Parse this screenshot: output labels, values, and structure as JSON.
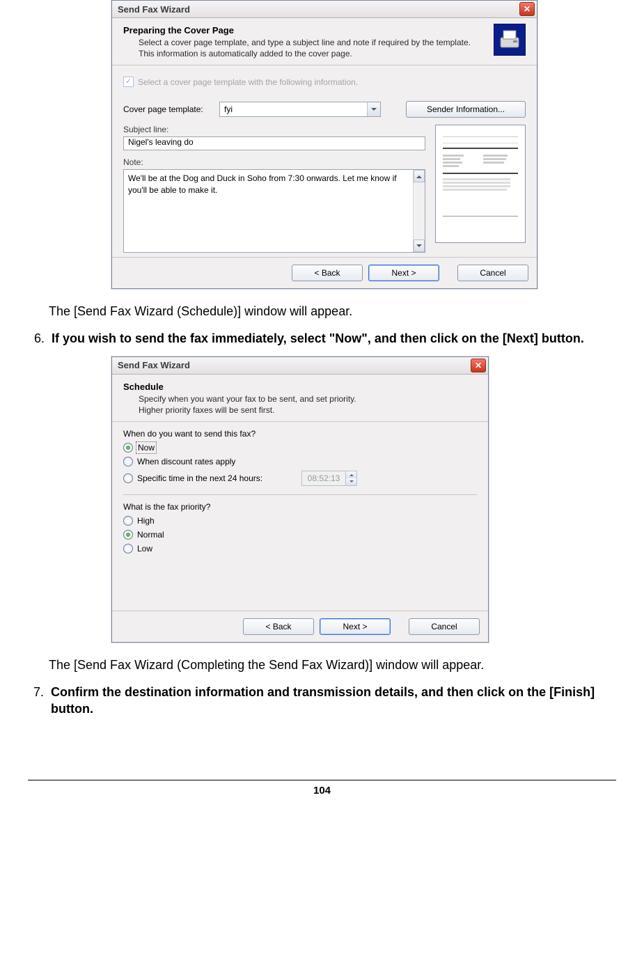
{
  "wizard1": {
    "title": "Send Fax Wizard",
    "heading": "Preparing the Cover Page",
    "sub1": "Select a cover page template, and type a subject line and note if required by the template.",
    "sub2": "This information is automatically added to the cover page.",
    "checkbox_label": "Select a cover page template with the following information.",
    "template_label": "Cover page template:",
    "template_value": "fyi",
    "sender_btn": "Sender Information...",
    "subject_label": "Subject line:",
    "subject_value": "Nigel's leaving do",
    "note_label": "Note:",
    "note_value": "We'll be at the Dog and Duck in Soho from 7:30 onwards. Let me know if you'll be able to make it.",
    "back": "< Back",
    "next": "Next >",
    "cancel": "Cancel"
  },
  "doc": {
    "after1": "The [Send Fax Wizard (Schedule)] window will appear.",
    "step6_num": "6.",
    "step6": "If you wish to send the fax immediately, select \"Now\", and then click on the [Next] button.",
    "after2": "The [Send Fax Wizard (Completing the Send Fax Wizard)] window will appear.",
    "step7_num": "7.",
    "step7": "Confirm the destination information and transmission details, and then click on the [Finish] button.",
    "page_number": "104"
  },
  "wizard2": {
    "title": "Send Fax Wizard",
    "heading": "Schedule",
    "sub1": "Specify when you want your fax to be sent, and set priority.",
    "sub2": "Higher priority faxes will be sent first.",
    "q1": "When do you want to send this fax?",
    "opt_now": "Now",
    "opt_discount": "When discount rates apply",
    "opt_specific": "Specific time in the next 24 hours:",
    "time_value": "08:52:13",
    "q2": "What is the fax priority?",
    "opt_high": "High",
    "opt_normal": "Normal",
    "opt_low": "Low",
    "back": "< Back",
    "next": "Next >",
    "cancel": "Cancel"
  }
}
